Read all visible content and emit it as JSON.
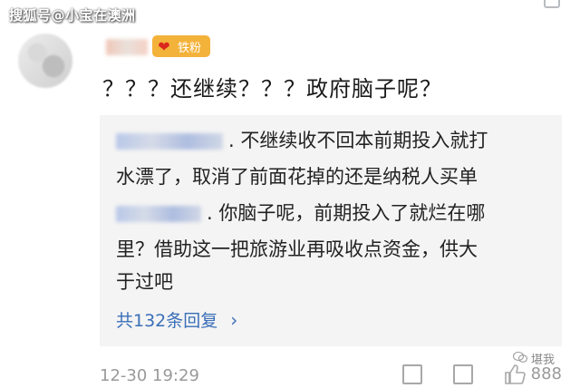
{
  "watermark": "搜狐号@小宝在澳洲",
  "comment": {
    "badge_label": "铁粉",
    "text": "？？？还继续？？？政府脑子呢？",
    "time": "12-30 19:29",
    "like_count": "888"
  },
  "replies": {
    "line1": ". 不继续收不回本前期投入就打",
    "line2": "水漂了，取消了前面花掉的还是纳税人买单",
    "line3": ". 你脑子呢，前期投入了就烂在哪",
    "line4": "里？借助这一把旅游业再吸收点资金，供大",
    "line5": "于过吧",
    "more_label": "共132条回复",
    "chevron": "›"
  },
  "overlay": {
    "wechat_label": "堪我"
  },
  "icons": {
    "share": "share-icon",
    "comment": "comment-icon",
    "like": "thumbs-up-icon",
    "wechat": "wechat-icon"
  },
  "colors": {
    "badge": "#f3b23a",
    "link": "#3a6fb8",
    "reply_bg": "#f4f4f4"
  }
}
